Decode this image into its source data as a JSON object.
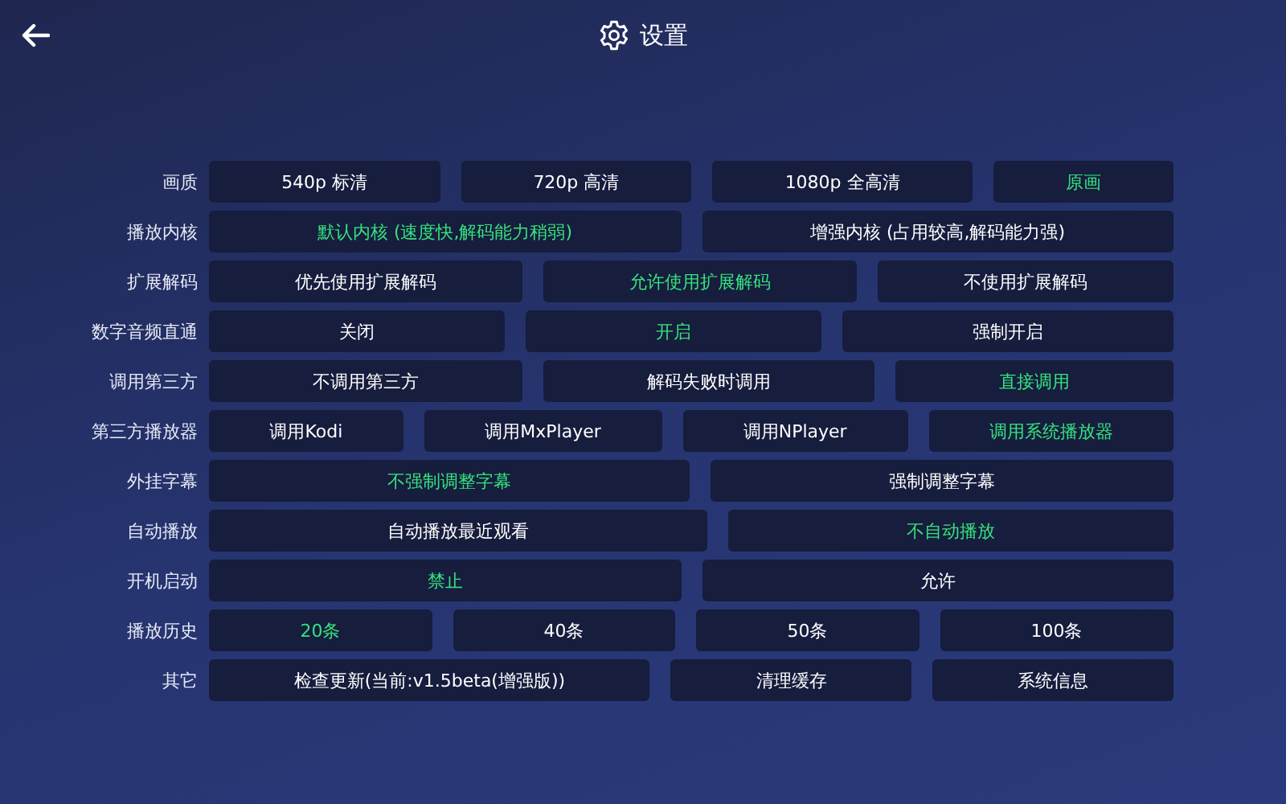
{
  "header": {
    "title": "设置"
  },
  "settings": [
    {
      "label": "画质",
      "options": [
        {
          "text": "540p 标清",
          "selected": false
        },
        {
          "text": "720p 高清",
          "selected": false
        },
        {
          "text": "1080p 全高清",
          "selected": false
        },
        {
          "text": "原画",
          "selected": true
        }
      ]
    },
    {
      "label": "播放内核",
      "options": [
        {
          "text": "默认内核 (速度快,解码能力稍弱)",
          "selected": true
        },
        {
          "text": "增强内核 (占用较高,解码能力强)",
          "selected": false
        }
      ]
    },
    {
      "label": "扩展解码",
      "options": [
        {
          "text": "优先使用扩展解码",
          "selected": false
        },
        {
          "text": "允许使用扩展解码",
          "selected": true
        },
        {
          "text": "不使用扩展解码",
          "selected": false
        }
      ]
    },
    {
      "label": "数字音频直通",
      "options": [
        {
          "text": "关闭",
          "selected": false
        },
        {
          "text": "开启",
          "selected": true
        },
        {
          "text": "强制开启",
          "selected": false
        }
      ]
    },
    {
      "label": "调用第三方",
      "options": [
        {
          "text": "不调用第三方",
          "selected": false
        },
        {
          "text": "解码失败时调用",
          "selected": false
        },
        {
          "text": "直接调用",
          "selected": true
        }
      ]
    },
    {
      "label": "第三方播放器",
      "options": [
        {
          "text": "调用Kodi",
          "selected": false
        },
        {
          "text": "调用MxPlayer",
          "selected": false
        },
        {
          "text": "调用NPlayer",
          "selected": false
        },
        {
          "text": "调用系统播放器",
          "selected": true
        }
      ]
    },
    {
      "label": "外挂字幕",
      "options": [
        {
          "text": "不强制调整字幕",
          "selected": true
        },
        {
          "text": "强制调整字幕",
          "selected": false
        }
      ]
    },
    {
      "label": "自动播放",
      "options": [
        {
          "text": "自动播放最近观看",
          "selected": false
        },
        {
          "text": "不自动播放",
          "selected": true
        }
      ]
    },
    {
      "label": "开机启动",
      "options": [
        {
          "text": "禁止",
          "selected": true
        },
        {
          "text": "允许",
          "selected": false
        }
      ]
    },
    {
      "label": "播放历史",
      "options": [
        {
          "text": "20条",
          "selected": true
        },
        {
          "text": "40条",
          "selected": false
        },
        {
          "text": "50条",
          "selected": false
        },
        {
          "text": "100条",
          "selected": false
        }
      ]
    },
    {
      "label": "其它",
      "options": [
        {
          "text": "检查更新(当前:v1.5beta(增强版))",
          "selected": false
        },
        {
          "text": "清理缓存",
          "selected": false
        },
        {
          "text": "系统信息",
          "selected": false
        }
      ]
    }
  ]
}
